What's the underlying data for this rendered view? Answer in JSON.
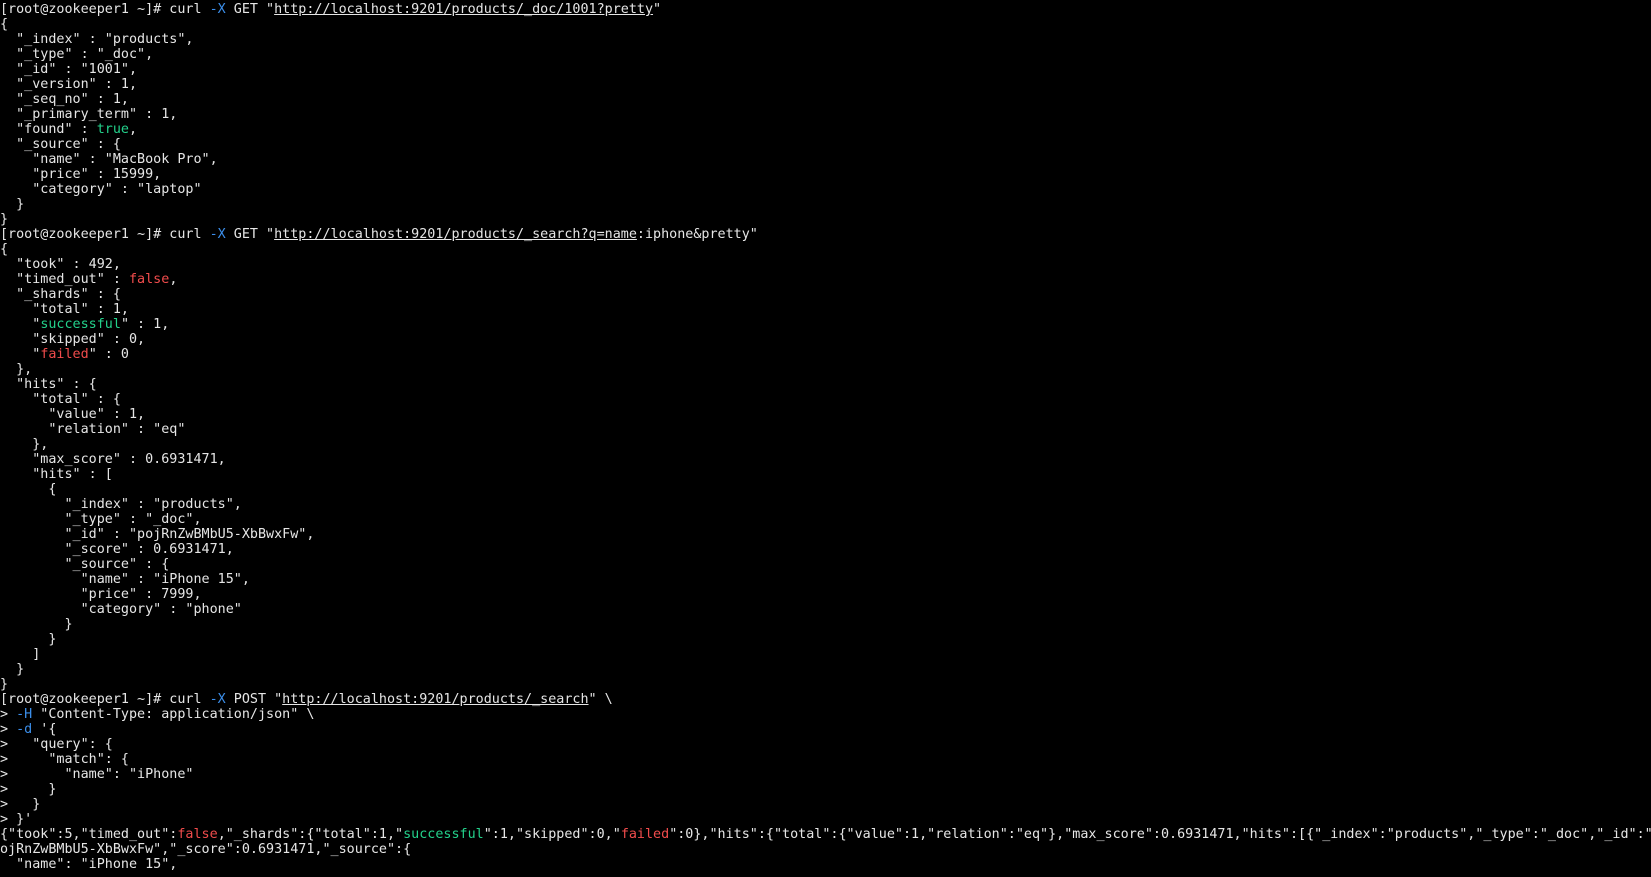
{
  "terminal": {
    "colors": {
      "background": "#000000",
      "foreground": "#e6e6e6",
      "green": "#23d18b",
      "red": "#f14c4c",
      "blue": "#3b8eea"
    },
    "lines": [
      [
        {
          "t": "[root@zookeeper1 ~]# curl "
        },
        {
          "t": "-X",
          "c": "b"
        },
        {
          "t": " GET \""
        },
        {
          "t": "http://localhost:9201/products/_doc/1001?pretty",
          "u": true
        },
        {
          "t": "\""
        }
      ],
      [
        {
          "t": "{"
        }
      ],
      [
        {
          "t": "  \"_index\" : \"products\","
        }
      ],
      [
        {
          "t": "  \"_type\" : \"_doc\","
        }
      ],
      [
        {
          "t": "  \"_id\" : \"1001\","
        }
      ],
      [
        {
          "t": "  \"_version\" : 1,"
        }
      ],
      [
        {
          "t": "  \"_seq_no\" : 1,"
        }
      ],
      [
        {
          "t": "  \"_primary_term\" : 1,"
        }
      ],
      [
        {
          "t": "  \"found\" : "
        },
        {
          "t": "true",
          "c": "g"
        },
        {
          "t": ","
        }
      ],
      [
        {
          "t": "  \"_source\" : {"
        }
      ],
      [
        {
          "t": "    \"name\" : \"MacBook Pro\","
        }
      ],
      [
        {
          "t": "    \"price\" : 15999,"
        }
      ],
      [
        {
          "t": "    \"category\" : \"laptop\""
        }
      ],
      [
        {
          "t": "  }"
        }
      ],
      [
        {
          "t": "}"
        }
      ],
      [
        {
          "t": "[root@zookeeper1 ~]# curl "
        },
        {
          "t": "-X",
          "c": "b"
        },
        {
          "t": " GET \""
        },
        {
          "t": "http://localhost:9201/products/_search?q=name",
          "u": true
        },
        {
          "t": ":iphone&pretty\""
        }
      ],
      [
        {
          "t": "{"
        }
      ],
      [
        {
          "t": "  \"took\" : 492,"
        }
      ],
      [
        {
          "t": "  \"timed_out\" : "
        },
        {
          "t": "false",
          "c": "r"
        },
        {
          "t": ","
        }
      ],
      [
        {
          "t": "  \"_shards\" : {"
        }
      ],
      [
        {
          "t": "    \"total\" : 1,"
        }
      ],
      [
        {
          "t": "    \""
        },
        {
          "t": "successful",
          "c": "g"
        },
        {
          "t": "\" : 1,"
        }
      ],
      [
        {
          "t": "    \"skipped\" : 0,"
        }
      ],
      [
        {
          "t": "    \""
        },
        {
          "t": "failed",
          "c": "r"
        },
        {
          "t": "\" : 0"
        }
      ],
      [
        {
          "t": "  },"
        }
      ],
      [
        {
          "t": "  \"hits\" : {"
        }
      ],
      [
        {
          "t": "    \"total\" : {"
        }
      ],
      [
        {
          "t": "      \"value\" : 1,"
        }
      ],
      [
        {
          "t": "      \"relation\" : \"eq\""
        }
      ],
      [
        {
          "t": "    },"
        }
      ],
      [
        {
          "t": "    \"max_score\" : 0.6931471,"
        }
      ],
      [
        {
          "t": "    \"hits\" : ["
        }
      ],
      [
        {
          "t": "      {"
        }
      ],
      [
        {
          "t": "        \"_index\" : \"products\","
        }
      ],
      [
        {
          "t": "        \"_type\" : \"_doc\","
        }
      ],
      [
        {
          "t": "        \"_id\" : \"pojRnZwBMbU5-XbBwxFw\","
        }
      ],
      [
        {
          "t": "        \"_score\" : 0.6931471,"
        }
      ],
      [
        {
          "t": "        \"_source\" : {"
        }
      ],
      [
        {
          "t": "          \"name\" : \"iPhone 15\","
        }
      ],
      [
        {
          "t": "          \"price\" : 7999,"
        }
      ],
      [
        {
          "t": "          \"category\" : \"phone\""
        }
      ],
      [
        {
          "t": "        }"
        }
      ],
      [
        {
          "t": "      }"
        }
      ],
      [
        {
          "t": "    ]"
        }
      ],
      [
        {
          "t": "  }"
        }
      ],
      [
        {
          "t": "}"
        }
      ],
      [
        {
          "t": "[root@zookeeper1 ~]# curl "
        },
        {
          "t": "-X",
          "c": "b"
        },
        {
          "t": " POST \""
        },
        {
          "t": "http://localhost:9201/products/_search",
          "u": true
        },
        {
          "t": "\" \\"
        }
      ],
      [
        {
          "t": "> "
        },
        {
          "t": "-H",
          "c": "b"
        },
        {
          "t": " \"Content-Type: application/json\" \\"
        }
      ],
      [
        {
          "t": "> "
        },
        {
          "t": "-d",
          "c": "b"
        },
        {
          "t": " '{"
        }
      ],
      [
        {
          "t": ">   \"query\": {"
        }
      ],
      [
        {
          "t": ">     \"match\": {"
        }
      ],
      [
        {
          "t": ">       \"name\": \"iPhone\""
        }
      ],
      [
        {
          "t": ">     }"
        }
      ],
      [
        {
          "t": ">   }"
        }
      ],
      [
        {
          "t": "> }'"
        }
      ],
      [
        {
          "t": "{\"took\":5,\"timed_out\":"
        },
        {
          "t": "false",
          "c": "r"
        },
        {
          "t": ",\"_shards\":{\"total\":1,\""
        },
        {
          "t": "successful",
          "c": "g"
        },
        {
          "t": "\":1,\"skipped\":0,\""
        },
        {
          "t": "failed",
          "c": "r"
        },
        {
          "t": "\":0},\"hits\":{\"total\":{\"value\":1,\"relation\":\"eq\"},\"max_score\":0.6931471,\"hits\":[{\"_index\":\"products\",\"_type\":\"_doc\",\"_id\":\"p"
        }
      ],
      [
        {
          "t": "ojRnZwBMbU5-XbBwxFw\",\"_score\":0.6931471,\"_source\":{"
        }
      ],
      [
        {
          "t": "  \"name\": \"iPhone 15\","
        }
      ]
    ]
  }
}
